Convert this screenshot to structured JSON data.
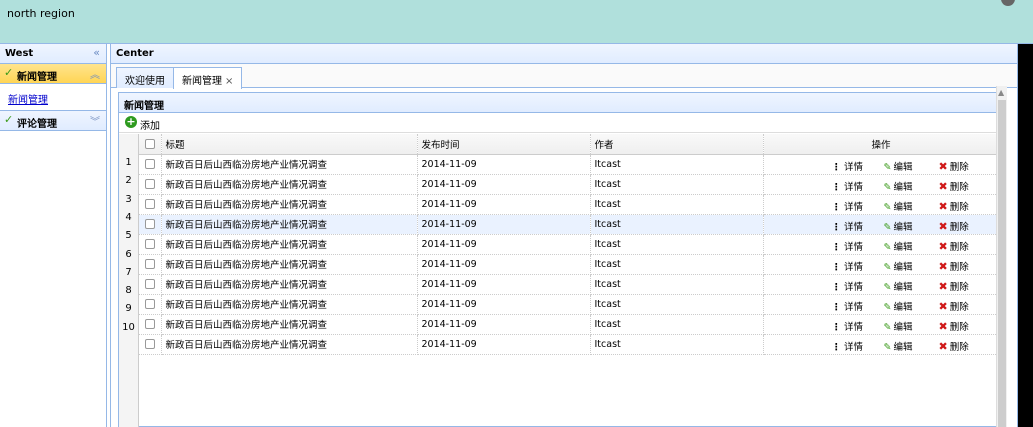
{
  "north": {
    "title": "north region"
  },
  "west": {
    "title": "West",
    "accordion": [
      {
        "label": "新闻管理",
        "links": [
          "新闻管理"
        ]
      },
      {
        "label": "评论管理"
      }
    ]
  },
  "center": {
    "title": "Center",
    "tabs": [
      {
        "label": "欢迎使用"
      },
      {
        "label": "新闻管理",
        "close": "×"
      }
    ]
  },
  "grid": {
    "title": "新闻管理",
    "toolbar": {
      "add_label": "添加"
    },
    "columns": [
      "标题",
      "发布时间",
      "作者",
      "操作"
    ],
    "actions": {
      "detail": "详情",
      "edit": "编辑",
      "delete": "删除"
    },
    "row_numbers": [
      "1",
      "2",
      "3",
      "4",
      "5",
      "6",
      "7",
      "8",
      "9",
      "10"
    ],
    "rows": [
      {
        "title": "新政百日后山西临汾房地产业情况调查",
        "date": "2014-11-09",
        "author": "Itcast"
      },
      {
        "title": "新政百日后山西临汾房地产业情况调查",
        "date": "2014-11-09",
        "author": "Itcast"
      },
      {
        "title": "新政百日后山西临汾房地产业情况调查",
        "date": "2014-11-09",
        "author": "Itcast"
      },
      {
        "title": "新政百日后山西临汾房地产业情况调查",
        "date": "2014-11-09",
        "author": "Itcast"
      },
      {
        "title": "新政百日后山西临汾房地产业情况调查",
        "date": "2014-11-09",
        "author": "Itcast"
      },
      {
        "title": "新政百日后山西临汾房地产业情况调查",
        "date": "2014-11-09",
        "author": "Itcast"
      },
      {
        "title": "新政百日后山西临汾房地产业情况调查",
        "date": "2014-11-09",
        "author": "Itcast"
      },
      {
        "title": "新政百日后山西临汾房地产业情况调查",
        "date": "2014-11-09",
        "author": "Itcast"
      },
      {
        "title": "新政百日后山西临汾房地产业情况调查",
        "date": "2014-11-09",
        "author": "Itcast"
      },
      {
        "title": "新政百日后山西临汾房地产业情况调查",
        "date": "2014-11-09",
        "author": "Itcast"
      }
    ]
  },
  "colors": {
    "north_bg": "#b0e0dc",
    "selected_accordion": "#ffd555",
    "border": "#95b8e7",
    "link": "#0000cc",
    "delete_red": "#d01818",
    "edit_green": "#3a9a1a"
  },
  "icons": {
    "check": "check-icon",
    "collapse": "double-chevron-left-icon",
    "add": "add-circle-icon",
    "detail": "dots-vertical-icon",
    "edit": "pencil-icon",
    "delete": "delete-x-icon"
  }
}
